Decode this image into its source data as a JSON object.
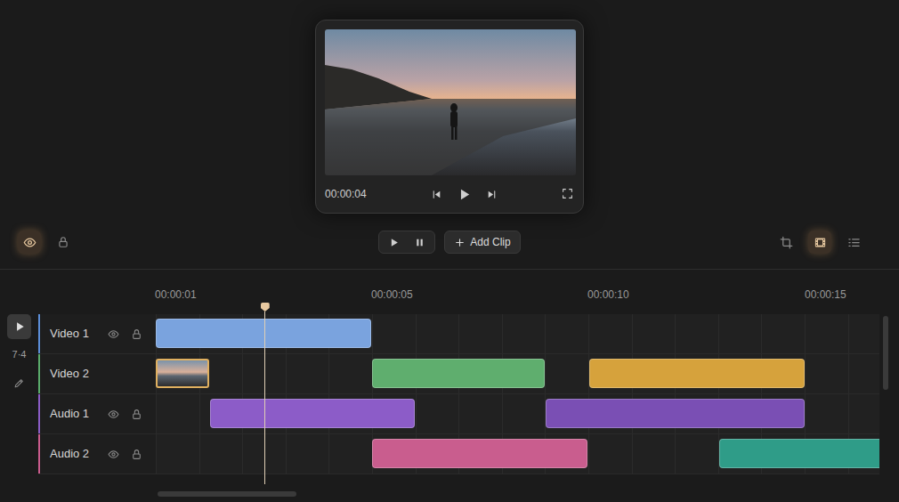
{
  "preview": {
    "time": "00:00:04",
    "playing": false
  },
  "toolbar": {
    "eye_selected": true,
    "add_clip": "Add Clip",
    "view_buttons": [
      {
        "selected": false
      },
      {
        "selected": true
      },
      {
        "selected": false
      }
    ]
  },
  "ruler": [
    "00:00:01",
    "00:00:05",
    "00:00:10",
    "00:00:15"
  ],
  "gutter": {
    "label": "7·4"
  },
  "playhead": {
    "level": 0.151
  },
  "tracks": [
    {
      "name": "Video 1",
      "color": "#5b8dd6",
      "controls": true,
      "clips": [
        {
          "kind": "block",
          "color": "#7aa3de"
        }
      ]
    },
    {
      "name": "Video 2",
      "color": "#5aaa6a",
      "controls": false,
      "clips": [
        {
          "kind": "thumbnail",
          "color": "#e0b060"
        },
        {
          "kind": "block",
          "color": "#5fae6e"
        },
        {
          "kind": "block",
          "color": "#d6a23c"
        }
      ]
    },
    {
      "name": "Audio 1",
      "color": "#8a5cc4",
      "controls": true,
      "clips": [
        {
          "kind": "block",
          "color": "#8c5cc8"
        },
        {
          "kind": "block",
          "color": "#7a4fb4"
        }
      ]
    },
    {
      "name": "Audio 2",
      "color": "#c95b8c",
      "controls": true,
      "clips": [
        {
          "kind": "block",
          "color": "#c95d8e"
        },
        {
          "kind": "block",
          "color": "#2f9c88"
        }
      ]
    }
  ]
}
